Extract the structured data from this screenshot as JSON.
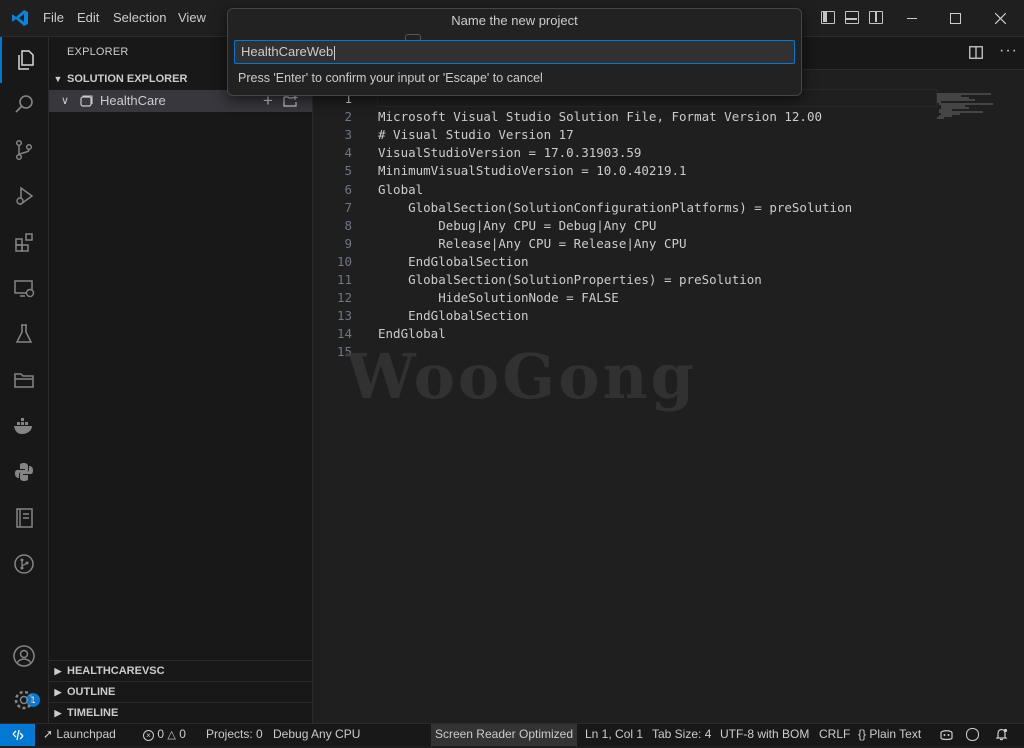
{
  "menu": {
    "file": "File",
    "edit": "Edit",
    "selection": "Selection",
    "view": "View"
  },
  "sidebar": {
    "title": "EXPLORER",
    "solution_explorer": "SOLUTION EXPLORER",
    "project": "HealthCare",
    "sections": [
      "HEALTHCAREVSC",
      "OUTLINE",
      "TIMELINE"
    ]
  },
  "quick_input": {
    "title": "Name the new project",
    "value": "HealthCareWeb",
    "hint": "Press 'Enter' to confirm your input or 'Escape' to cancel"
  },
  "editor": {
    "lines": [
      "",
      "Microsoft Visual Studio Solution File, Format Version 12.00",
      "# Visual Studio Version 17",
      "VisualStudioVersion = 17.0.31903.59",
      "MinimumVisualStudioVersion = 10.0.40219.1",
      "Global",
      "    GlobalSection(SolutionConfigurationPlatforms) = preSolution",
      "        Debug|Any CPU = Debug|Any CPU",
      "        Release|Any CPU = Release|Any CPU",
      "    EndGlobalSection",
      "    GlobalSection(SolutionProperties) = preSolution",
      "        HideSolutionNode = FALSE",
      "    EndGlobalSection",
      "EndGlobal",
      ""
    ],
    "line_numbers": [
      "1",
      "2",
      "3",
      "4",
      "5",
      "6",
      "7",
      "8",
      "9",
      "10",
      "11",
      "12",
      "13",
      "14",
      "15"
    ]
  },
  "watermark": "WooGong",
  "accounts_badge": "1",
  "status": {
    "launchpad": "Launchpad",
    "errors": "0",
    "warnings": "0",
    "projects": "Projects: 0",
    "config": "Debug Any CPU",
    "screen_reader": "Screen Reader Optimized",
    "position": "Ln 1, Col 1",
    "tab_size": "Tab Size: 4",
    "encoding": "UTF-8 with BOM",
    "eol": "CRLF",
    "language": "Plain Text",
    "language_icon": "{}"
  },
  "colors": {
    "accent": "#0078d4",
    "background": "#1f1f1f"
  }
}
